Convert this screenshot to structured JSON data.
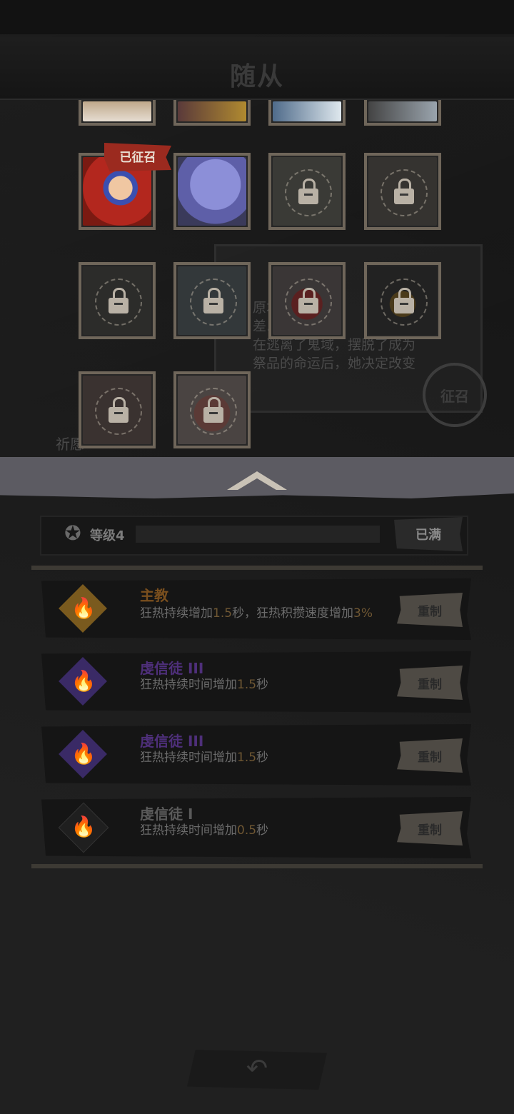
{
  "header": {
    "title": "随从"
  },
  "grid": {
    "recruited_tag": "已征召",
    "description": "原本…品的\n差…字…\n在逃离了鬼域，摆脱了成为\n祭品的命运后，她决定改变",
    "recruit_stamp": "征召",
    "side_label": "祈愿"
  },
  "level": {
    "label": "等级4",
    "max_label": "已满"
  },
  "skills": [
    {
      "name": "主教",
      "desc_part1": "狂热持续增加",
      "desc_num1": "1.5",
      "desc_part2": "秒，狂热积攒速度增加",
      "desc_num2": "3%",
      "desc_part3": "",
      "color": "#7a4f1e",
      "reset": "重制"
    },
    {
      "name": "虔信徒 III",
      "desc_part1": "狂热持续时间增加",
      "desc_num1": "1.5",
      "desc_part2": "秒",
      "color": "#4e2f7a",
      "reset": "重制"
    },
    {
      "name": "虔信徒 III",
      "desc_part1": "狂热持续时间增加",
      "desc_num1": "1.5",
      "desc_part2": "秒",
      "color": "#4e2f7a",
      "reset": "重制"
    },
    {
      "name": "虔信徒 I",
      "desc_part1": "狂热持续时间增加",
      "desc_num1": "0.5",
      "desc_part2": "秒",
      "color": "#2a2a2a",
      "reset": "重制"
    }
  ],
  "colors": {
    "accent_gold": "#7a5a2a",
    "accent_purple": "#4e2f7a",
    "recruited_red": "#9b2a1f"
  },
  "icons": {
    "lock": "lock-icon",
    "flame": "flame-icon",
    "back": "back-arrow-icon",
    "level": "medal-icon"
  }
}
